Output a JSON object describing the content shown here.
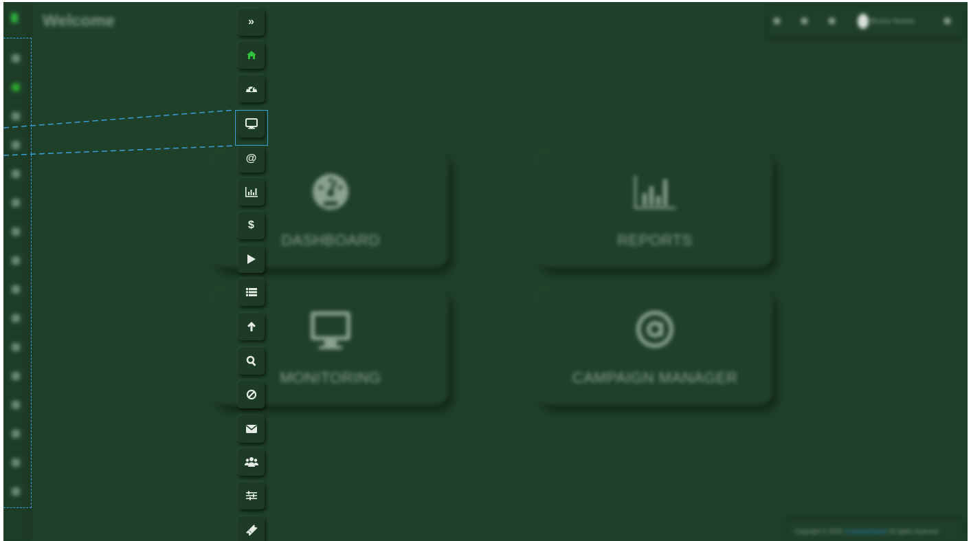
{
  "window": {
    "title": "Welcome"
  },
  "header": {
    "user_name": "Bruno Nunes",
    "icons": [
      "pin-icon",
      "settings-icon",
      "bell-icon",
      "power-icon"
    ]
  },
  "cards": [
    {
      "label": "DASHBOARD",
      "icon": "gauge-icon"
    },
    {
      "label": "REPORTS",
      "icon": "bar-chart-icon"
    },
    {
      "label": "MONITORING",
      "icon": "monitor-icon"
    },
    {
      "label": "CAMPAIGN MANAGER",
      "icon": "at-icon"
    }
  ],
  "sidebar": {
    "expand_glyph": "»",
    "items": [
      {
        "name": "home",
        "icon": "home-icon",
        "active": true
      },
      {
        "name": "dashboard",
        "icon": "gauge-icon"
      },
      {
        "name": "monitoring",
        "icon": "monitor-icon"
      },
      {
        "name": "campaign",
        "icon": "at-icon",
        "glyph": "@"
      },
      {
        "name": "reports",
        "icon": "bar-chart-icon"
      },
      {
        "name": "billing",
        "icon": "dollar-icon",
        "glyph": "$"
      },
      {
        "name": "play",
        "icon": "play-icon"
      },
      {
        "name": "list",
        "icon": "list-icon"
      },
      {
        "name": "upload",
        "icon": "arrow-up-icon"
      },
      {
        "name": "search",
        "icon": "search-icon"
      },
      {
        "name": "block",
        "icon": "block-icon"
      },
      {
        "name": "mail",
        "icon": "envelope-icon"
      },
      {
        "name": "users",
        "icon": "users-icon"
      },
      {
        "name": "settings",
        "icon": "sliders-icon"
      },
      {
        "name": "tickets",
        "icon": "ticket-icon"
      }
    ]
  },
  "footer": {
    "prefix": "Copyright © 2020",
    "brand": "CompanyName",
    "suffix": "All rights reserved."
  },
  "colors": {
    "background": "#1f4029",
    "active_green": "#31c23b",
    "highlight_blue": "#3aa0d8",
    "link_blue": "#2e8fd6"
  }
}
